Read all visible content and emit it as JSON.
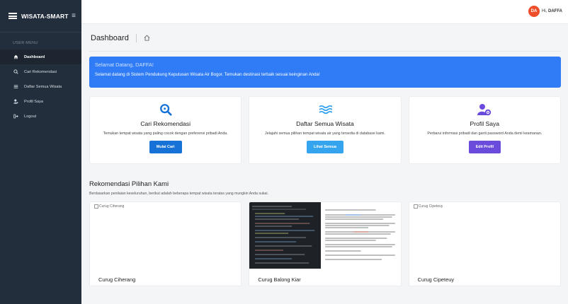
{
  "sidebar": {
    "brand": "WISATA-SMART",
    "menu_label": "USER MENU",
    "items": [
      {
        "label": "Dashboard",
        "icon": "home-icon",
        "active": true
      },
      {
        "label": "Cari Rekomendasi",
        "icon": "search-icon",
        "active": false
      },
      {
        "label": "Daftar Semua Wisata",
        "icon": "list-icon",
        "active": false
      },
      {
        "label": "Profil Saya",
        "icon": "user-icon",
        "active": false
      },
      {
        "label": "Logout",
        "icon": "logout-icon",
        "active": false
      }
    ]
  },
  "topbar": {
    "avatar_initials": "DA",
    "greeting_prefix": "Hi,",
    "username": "DAFFA"
  },
  "page": {
    "title": "Dashboard"
  },
  "alert": {
    "heading": "Selamat Datang, DAFFA!",
    "message": "Selamat datang di Sistem Pendukung Keputusan Wisata Air Bogor. Temukan destinasi terbaik sesuai keinginan Anda!"
  },
  "cards": [
    {
      "title": "Cari Rekomendasi",
      "description": "Temukan tempat wisata yang paling cocok dengan preferensi pribadi Anda.",
      "button": "Mulai Cari",
      "icon": "search-icon",
      "color": "#1672d6"
    },
    {
      "title": "Daftar Semua Wisata",
      "description": "Jelajahi semua pilihan tempat wisata air yang tersedia di database kami.",
      "button": "Lihat Semua",
      "icon": "water-icon",
      "color": "#34a4ee"
    },
    {
      "title": "Profil Saya",
      "description": "Perbarui informasi pribadi dan ganti password Anda demi keamanan.",
      "button": "Edit Profil",
      "icon": "user-settings-icon",
      "color": "#6a4bdb"
    }
  ],
  "recommendations": {
    "title": "Rekomendasi Pilihan Kami",
    "subtitle": "Berdasarkan penilaian keseluruhan, berikut adalah beberapa tempat wisata teratas yang mungkin Anda sukai.",
    "items": [
      {
        "name": "Curug Ciherang",
        "image_alt": "Curug Ciherang"
      },
      {
        "name": "Curug Balong Kiar",
        "image_alt": ""
      },
      {
        "name": "Curug Cipeteuy",
        "image_alt": "Curug Cipeteuy"
      }
    ]
  },
  "colors": {
    "sidebar": "#232e3c",
    "alert": "#2f7cf6",
    "avatar": "#f04e2a"
  }
}
